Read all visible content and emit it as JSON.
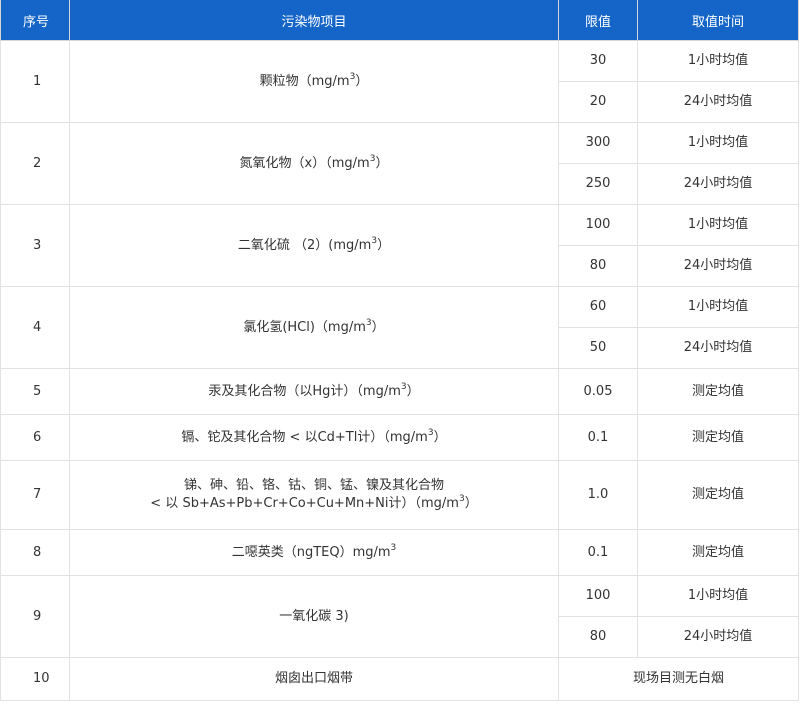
{
  "headers": {
    "index": "序号",
    "item": "污染物项目",
    "limit": "限值",
    "period": "取值时间"
  },
  "rows": [
    {
      "index": "1",
      "name": "颗粒物（mg/m",
      "sup": "3",
      "tail": "）",
      "values": [
        {
          "limit": "30",
          "period": "1小时均值"
        },
        {
          "limit": "20",
          "period": "24小时均值"
        }
      ]
    },
    {
      "index": "2",
      "name": "氮氧化物（x）（mg/m",
      "sup": "3",
      "tail": "）",
      "values": [
        {
          "limit": "300",
          "period": "1小时均值"
        },
        {
          "limit": "250",
          "period": "24小时均值"
        }
      ]
    },
    {
      "index": "3",
      "name": "二氧化硫 （2）(mg/m",
      "sup": "3",
      "tail": "）",
      "values": [
        {
          "limit": "100",
          "period": "1小时均值"
        },
        {
          "limit": "80",
          "period": "24小时均值"
        }
      ]
    },
    {
      "index": "4",
      "name": "氯化氢(HCl)（mg/m",
      "sup": "3",
      "tail": "）",
      "values": [
        {
          "limit": "60",
          "period": "1小时均值"
        },
        {
          "limit": "50",
          "period": "24小时均值"
        }
      ]
    },
    {
      "index": "5",
      "name": "汞及其化合物（以Hg计）（mg/m",
      "sup": "3",
      "tail": "）",
      "limit": "0.05",
      "period": "测定均值"
    },
    {
      "index": "6",
      "name": "镉、铊及其化合物 < 以Cd+Tl计）（mg/m",
      "sup": "3",
      "tail": "）",
      "limit": "0.1",
      "period": "测定均值"
    },
    {
      "index": "7",
      "name_line1": "锑、砷、铅、铬、钴、铜、锰、镍及其化合物",
      "name_line2": "< 以 Sb+As+Pb+Cr+Co+Cu+Mn+Ni计）（mg/m",
      "sup": "3",
      "tail": "）",
      "limit": "1.0",
      "period": "测定均值"
    },
    {
      "index": "8",
      "name": "二噁英类（ngTEQ）mg/m",
      "sup": "3",
      "tail": "",
      "limit": "0.1",
      "period": "测定均值"
    },
    {
      "index": "9",
      "name": "一氧化碳 3)",
      "values": [
        {
          "limit": "100",
          "period": "1小时均值"
        },
        {
          "limit": "80",
          "period": "24小时均值"
        }
      ]
    },
    {
      "index": "10",
      "name": "烟囱出口烟带",
      "merged": "现场目测无白烟"
    }
  ]
}
